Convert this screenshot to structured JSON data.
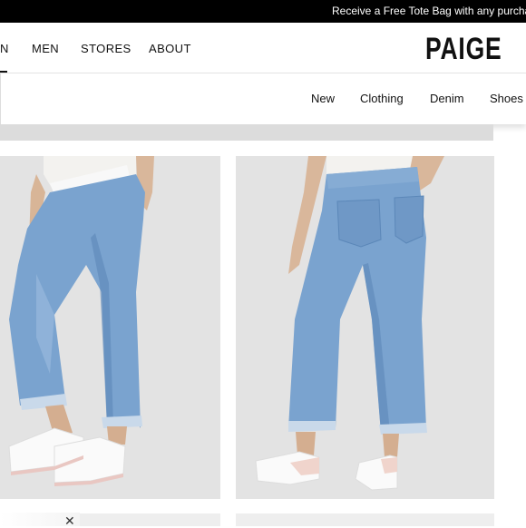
{
  "promo_bar": {
    "text": "Receive a Free Tote Bag with any purchase"
  },
  "top_nav": {
    "items": [
      {
        "label": "N"
      },
      {
        "label": "MEN"
      },
      {
        "label": "STORES"
      },
      {
        "label": "ABOUT"
      }
    ],
    "logo": "PAIGE"
  },
  "sub_nav": {
    "items": [
      {
        "label": "New"
      },
      {
        "label": "Clothing"
      },
      {
        "label": "Denim"
      },
      {
        "label": "Shoes"
      }
    ]
  },
  "products": [
    {
      "name_icon": "product-photo-front",
      "description": "front view jeans"
    },
    {
      "name_icon": "product-photo-back",
      "description": "back view jeans"
    }
  ],
  "colors": {
    "promo_bg": "#000000",
    "denim": "#7aa3cf",
    "denim_dark": "#5b87b8",
    "photo_bg": "#e4e4e4"
  }
}
